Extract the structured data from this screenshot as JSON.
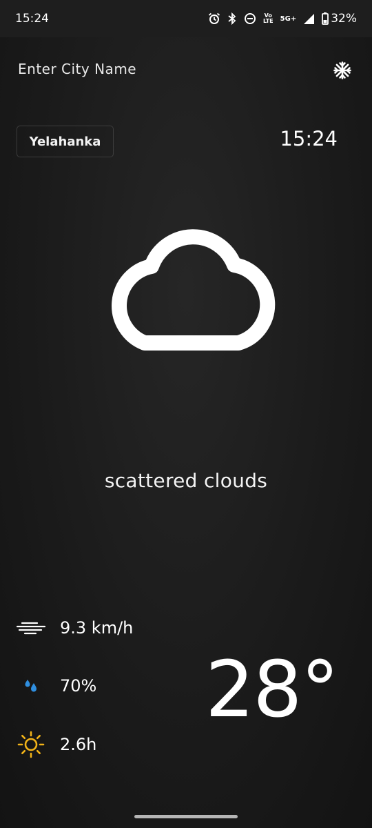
{
  "status_bar": {
    "time": "15:24",
    "net_top": "Vo",
    "net_bottom": "LTE",
    "network": "5G+",
    "battery": "32%"
  },
  "header": {
    "search_placeholder": "Enter City Name",
    "toggle_icon": "snowflake-icon"
  },
  "location": {
    "city": "Yelahanka",
    "time": "15:24"
  },
  "weather": {
    "icon": "cloud-icon",
    "description": "scattered clouds",
    "temperature": "28°"
  },
  "stats": {
    "wind": "9.3 km/h",
    "humidity": "70%",
    "sunshine": "2.6h"
  },
  "colors": {
    "background": "#1b1b1b",
    "humidity_icon": "#2f8fe0",
    "sun_icon": "#f2b318"
  }
}
